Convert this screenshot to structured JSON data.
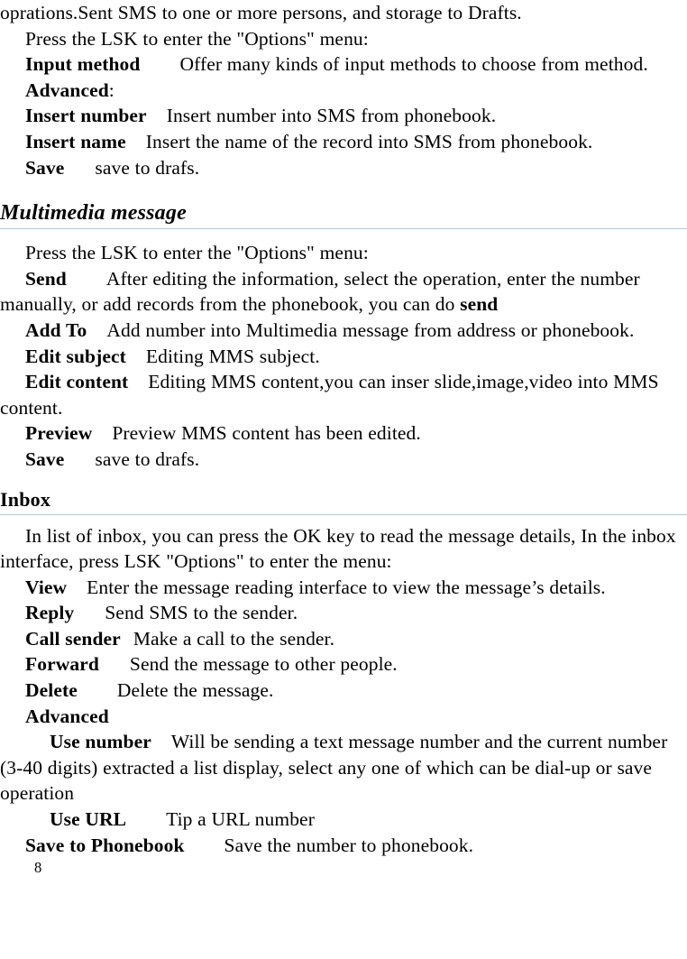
{
  "document": {
    "page_number": "8",
    "rule_color": "#b4c7d9",
    "text_color": "#000000",
    "background_color": "#ffffff"
  },
  "sms_section": {
    "lines": [
      {
        "id": "continuation",
        "indent": "none",
        "text": "oprations.Sent SMS to one or more persons, and storage to Drafts."
      },
      {
        "id": "press-lsk",
        "indent": "first",
        "text": "Press the LSK to enter the \"Options\" menu:"
      }
    ],
    "items": [
      {
        "term": "Input method",
        "gap": "xl",
        "desc": "Offer many kinds of input methods to choose from method."
      },
      {
        "term": "Advanced",
        "gap": "none",
        "desc": ":"
      },
      {
        "term": "Insert number",
        "gap": "md",
        "desc": "Insert number into SMS from phonebook."
      },
      {
        "term": "Insert name",
        "gap": "md",
        "desc": "Insert the name of the record into SMS from phonebook."
      },
      {
        "term": "Save",
        "gap": "lg",
        "desc": "save to drafs."
      }
    ]
  },
  "multimedia_section": {
    "heading": "Multimedia message",
    "intro": "Press the LSK to enter the \"Options\" menu:",
    "items": [
      {
        "term": "Send",
        "gap": "xl",
        "desc_before": "After editing the information, select the operation, enter the number manually, or add records from the phonebook, you can do ",
        "desc_bold_tail": "send"
      },
      {
        "term": "Add To",
        "gap": "md",
        "desc": "Add number into Multimedia message from address or phonebook."
      },
      {
        "term": "Edit subject",
        "gap": "md",
        "desc": "Editing MMS subject."
      },
      {
        "term": "Edit content",
        "gap": "md",
        "desc": "Editing MMS content,you can inser slide,image,video into MMS content."
      },
      {
        "term": "Preview",
        "gap": "md",
        "desc": "Preview MMS content has been edited."
      },
      {
        "term": "Save",
        "gap": "lg",
        "desc": "save to drafs."
      }
    ]
  },
  "inbox_section": {
    "heading": "Inbox",
    "intro": "In list of inbox, you can press the OK key to read the message details, In the inbox interface, press LSK \"Options\" to enter the menu:",
    "items": [
      {
        "term": "View",
        "gap": "md",
        "desc": "Enter the message reading interface to view the message’s details."
      },
      {
        "term": "Reply",
        "gap": "lg",
        "desc": "Send SMS to the sender."
      },
      {
        "term": "Call sender",
        "gap": "sm",
        "desc": "Make a call to the sender."
      },
      {
        "term": "Forward",
        "gap": "lg",
        "desc": "Send the message to other people."
      },
      {
        "term": "Delete",
        "gap": "xl",
        "desc": "Delete the message."
      },
      {
        "term": "Advanced",
        "gap": "none",
        "desc": ""
      }
    ],
    "advanced_items": [
      {
        "term": "Use number",
        "gap": "md",
        "desc": "Will be sending a text message number and the current number (3-40 digits) extracted a list display, select any one of which can be dial-up or save operation"
      },
      {
        "term": "Use URL",
        "gap": "xl",
        "desc": "Tip a URL number"
      }
    ],
    "final_item": {
      "term": "Save to Phonebook",
      "gap": "xl",
      "desc": "Save the number to phonebook."
    }
  }
}
